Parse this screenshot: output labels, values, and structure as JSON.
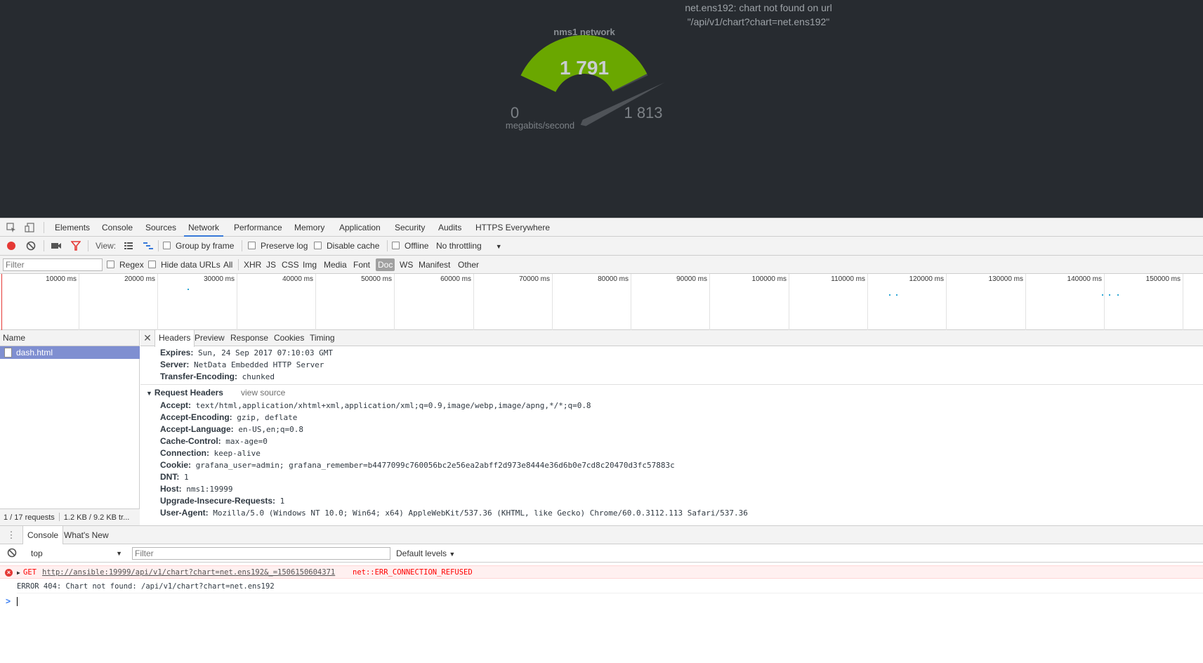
{
  "dashboard": {
    "chart_error_line1": "net.ens192: chart not found on url",
    "chart_error_line2": "\"/api/v1/chart?chart=net.ens192\"",
    "gauge": {
      "title": "nms1 network",
      "value_text": "1 791",
      "min_text": "0",
      "max_text": "1 813",
      "units": "megabits/second",
      "value": 1791,
      "min": 0,
      "max": 1813,
      "fill_color": "#6aa700",
      "track_color": "#42464b",
      "pointer_color": "#4f5358"
    }
  },
  "devtools": {
    "panel_tabs": [
      "Elements",
      "Console",
      "Sources",
      "Network",
      "Performance",
      "Memory",
      "Application",
      "Security",
      "Audits",
      "HTTPS Everywhere"
    ],
    "active_tab": "Network",
    "toolbar": {
      "view_label": "View:",
      "group_by_frame": "Group by frame",
      "preserve_log": "Preserve log",
      "disable_cache": "Disable cache",
      "offline": "Offline",
      "throttling": "No throttling"
    },
    "filter": {
      "placeholder": "Filter",
      "regex": "Regex",
      "hide_data_urls": "Hide data URLs",
      "types": [
        "All",
        "XHR",
        "JS",
        "CSS",
        "Img",
        "Media",
        "Font",
        "Doc",
        "WS",
        "Manifest",
        "Other"
      ],
      "active_type": "Doc"
    },
    "overview_ticks": [
      "10000 ms",
      "20000 ms",
      "30000 ms",
      "40000 ms",
      "50000 ms",
      "60000 ms",
      "70000 ms",
      "80000 ms",
      "90000 ms",
      "100000 ms",
      "110000 ms",
      "120000 ms",
      "130000 ms",
      "140000 ms",
      "150000 ms"
    ],
    "requests": {
      "header": "Name",
      "rows": [
        "dash.html"
      ],
      "status_count": "1 / 17 requests",
      "status_size": "1.2 KB / 9.2 KB tr..."
    },
    "detail_tabs": [
      "Headers",
      "Preview",
      "Response",
      "Cookies",
      "Timing"
    ],
    "active_detail_tab": "Headers",
    "response_headers": [
      {
        "k": "Expires:",
        "v": "Sun, 24 Sep 2017 07:10:03 GMT"
      },
      {
        "k": "Server:",
        "v": "NetData Embedded HTTP Server"
      },
      {
        "k": "Transfer-Encoding:",
        "v": "chunked"
      }
    ],
    "request_headers_title": "Request Headers",
    "view_source": "view source",
    "request_headers": [
      {
        "k": "Accept:",
        "v": "text/html,application/xhtml+xml,application/xml;q=0.9,image/webp,image/apng,*/*;q=0.8"
      },
      {
        "k": "Accept-Encoding:",
        "v": "gzip, deflate"
      },
      {
        "k": "Accept-Language:",
        "v": "en-US,en;q=0.8"
      },
      {
        "k": "Cache-Control:",
        "v": "max-age=0"
      },
      {
        "k": "Connection:",
        "v": "keep-alive"
      },
      {
        "k": "Cookie:",
        "v": "grafana_user=admin; grafana_remember=b4477099c760056bc2e56ea2abff2d973e8444e36d6b0e7cd8c20470d3fc57883c"
      },
      {
        "k": "DNT:",
        "v": "1"
      },
      {
        "k": "Host:",
        "v": "nms1:19999"
      },
      {
        "k": "Upgrade-Insecure-Requests:",
        "v": "1"
      },
      {
        "k": "User-Agent:",
        "v": "Mozilla/5.0 (Windows NT 10.0; Win64; x64) AppleWebKit/537.36 (KHTML, like Gecko) Chrome/60.0.3112.113 Safari/537.36"
      }
    ],
    "drawer": {
      "tabs": [
        "Console",
        "What's New"
      ],
      "active_tab": "Console",
      "context": "top",
      "filter_placeholder": "Filter",
      "levels": "Default levels"
    },
    "console": {
      "error_method": "GET",
      "error_url": "http://ansible:19999/api/v1/chart?chart=net.ens192&_=1506150604371",
      "error_code": "net::ERR_CONNECTION_REFUSED",
      "log_message": "ERROR 404: Chart not found: /api/v1/chart?chart=net.ens192",
      "prompt": ">"
    }
  }
}
